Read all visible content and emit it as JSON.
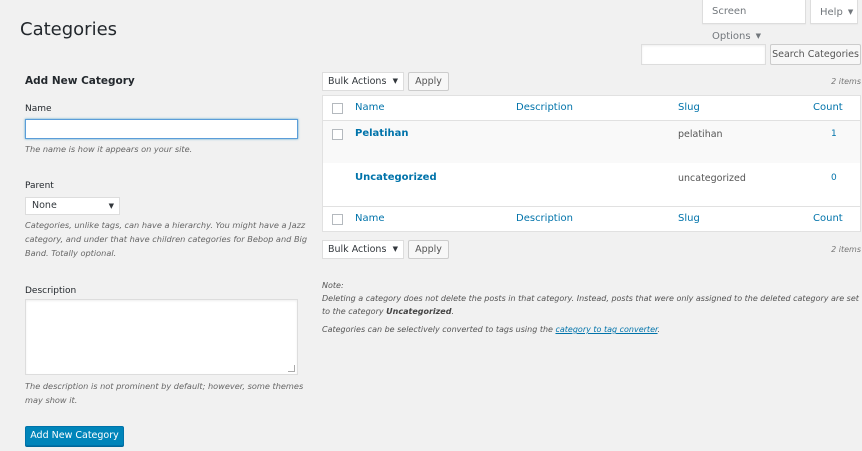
{
  "page": {
    "title": "Categories"
  },
  "screen_meta": {
    "screen_options": "Screen Options",
    "help": "Help",
    "caret": "▼"
  },
  "search": {
    "button": "Search Categories",
    "value": ""
  },
  "add_form": {
    "heading": "Add New Category",
    "name_label": "Name",
    "name_value": "",
    "name_help": "The name is how it appears on your site.",
    "parent_label": "Parent",
    "parent_selected": "None",
    "parent_help": "Categories, unlike tags, can have a hierarchy. You might have a Jazz category, and under that have children categories for Bebop and Big Band. Totally optional.",
    "description_label": "Description",
    "description_value": "",
    "description_help": "The description is not prominent by default; however, some themes may show it.",
    "submit": "Add New Category"
  },
  "tablenav": {
    "bulk_label": "Bulk Actions",
    "apply": "Apply",
    "items_count": "2 items"
  },
  "table": {
    "columns": {
      "name": "Name",
      "description": "Description",
      "slug": "Slug",
      "count": "Count"
    },
    "rows": [
      {
        "name": "Pelatihan",
        "description": "",
        "slug": "pelatihan",
        "count": "1"
      },
      {
        "name": "Uncategorized",
        "description": "",
        "slug": "uncategorized",
        "count": "0"
      }
    ]
  },
  "note": {
    "title": "Note:",
    "line1_a": "Deleting a category does not delete the posts in that category. Instead, posts that were only assigned to the deleted category are set to the category ",
    "line1_b": "Uncategorized",
    "line1_c": ".",
    "line2_a": "Categories can be selectively converted to tags using the ",
    "line2_link": "category to tag converter",
    "line2_c": "."
  }
}
